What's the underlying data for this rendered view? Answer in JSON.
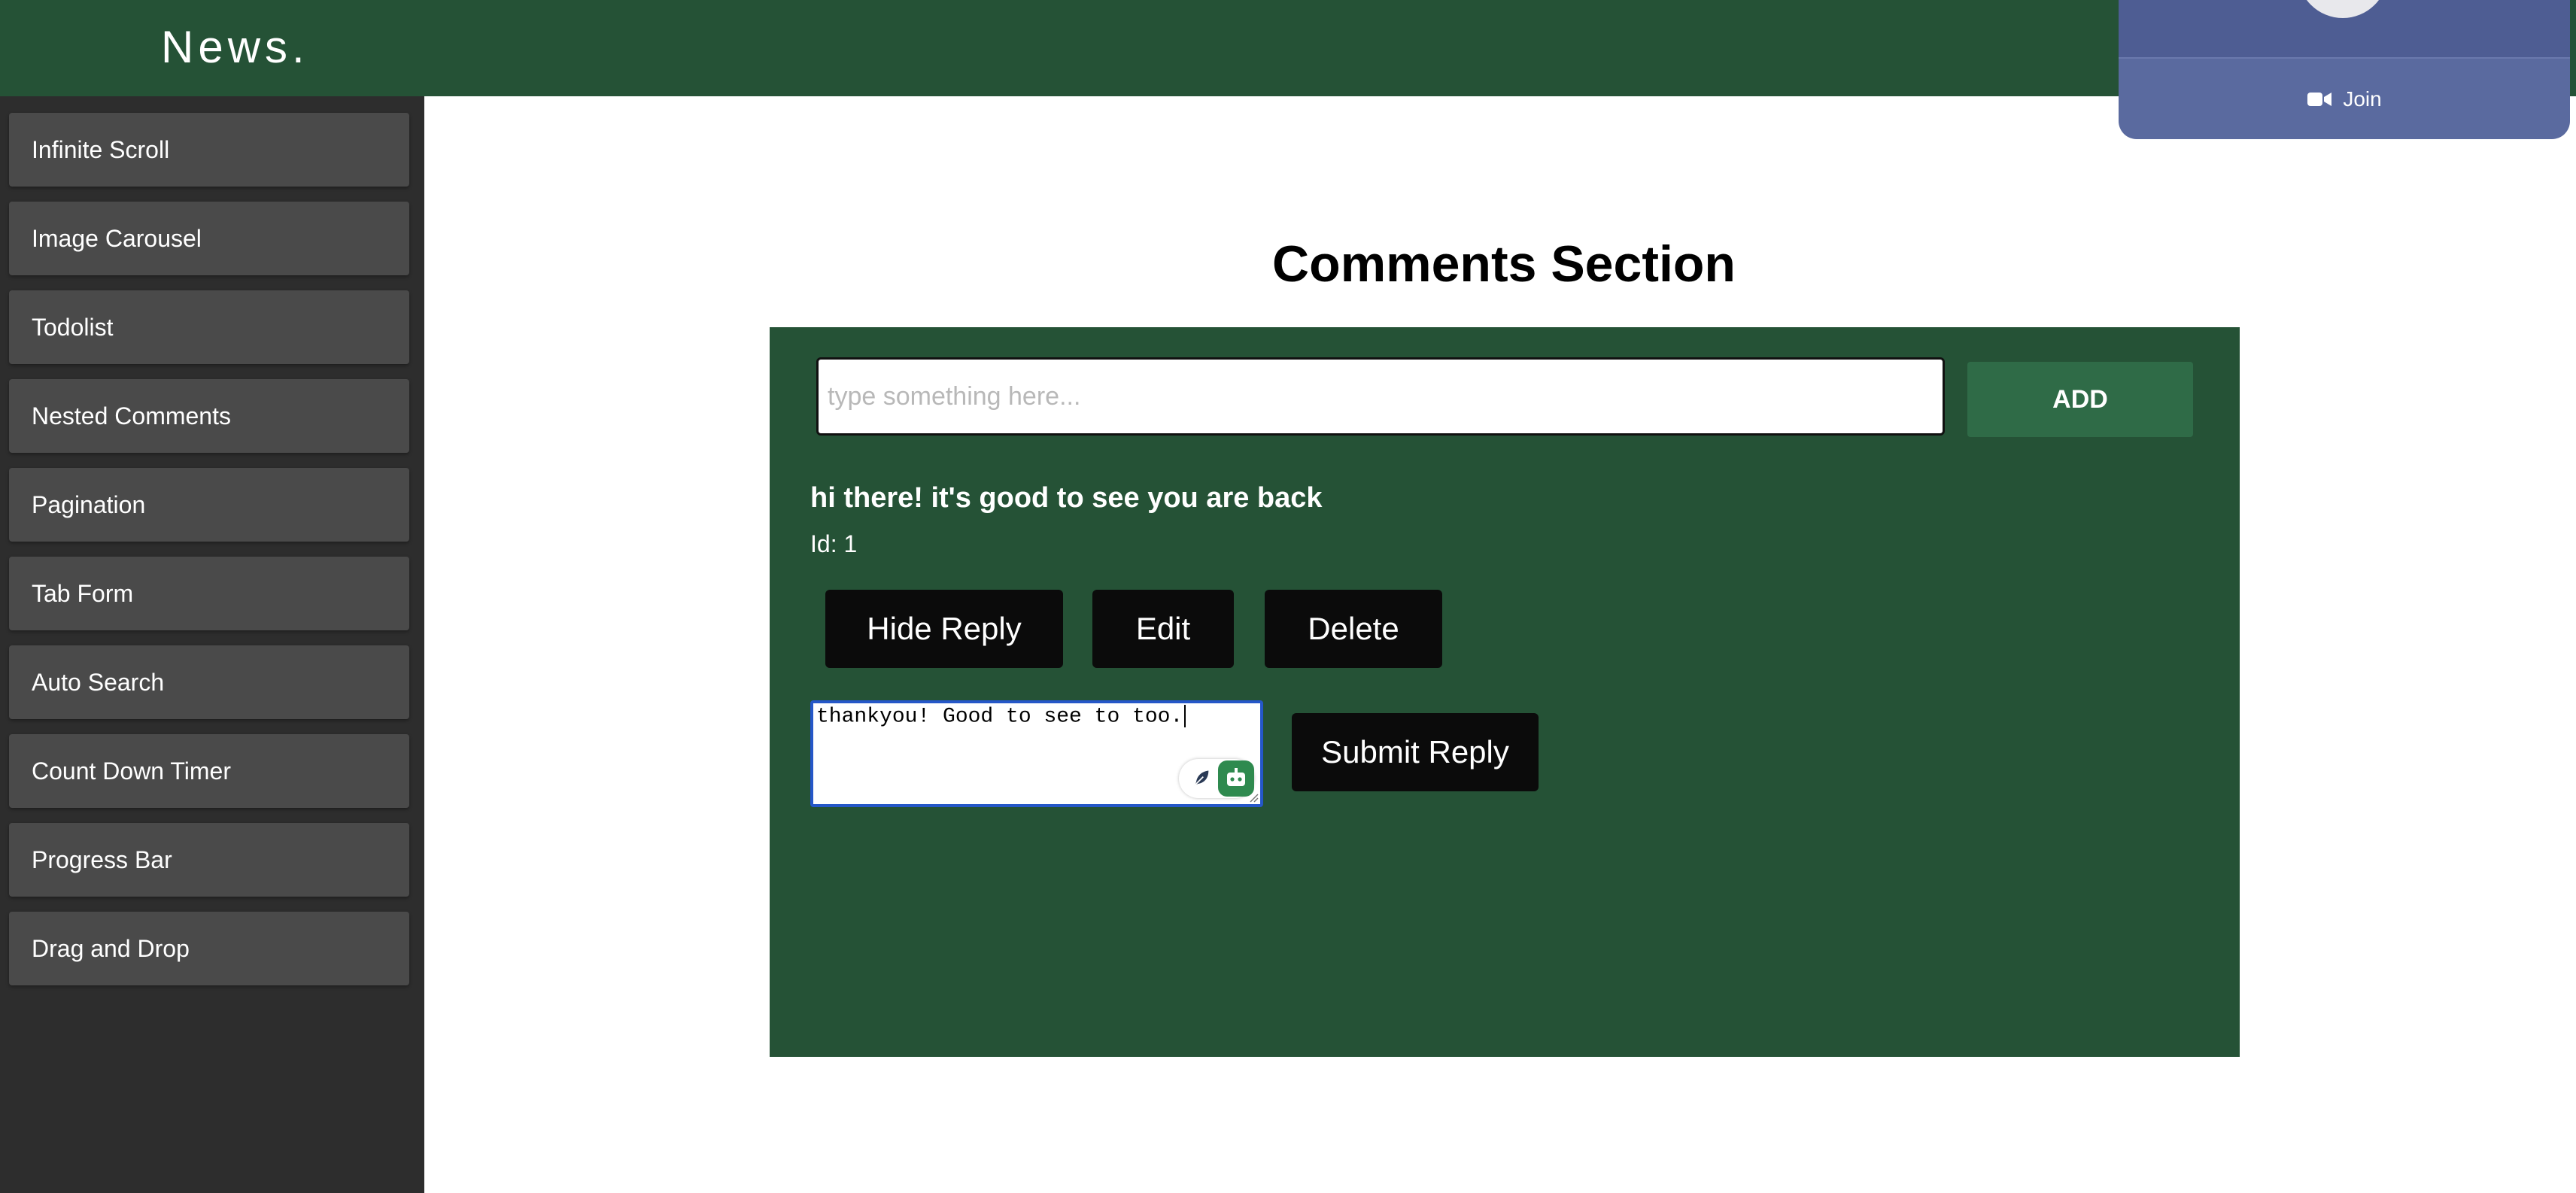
{
  "header": {
    "brand": "News."
  },
  "sidebar": {
    "items": [
      {
        "label": "Infinite Scroll"
      },
      {
        "label": "Image Carousel"
      },
      {
        "label": "Todolist"
      },
      {
        "label": "Nested Comments"
      },
      {
        "label": "Pagination"
      },
      {
        "label": "Tab Form"
      },
      {
        "label": "Auto Search"
      },
      {
        "label": "Count Down Timer"
      },
      {
        "label": "Progress Bar"
      },
      {
        "label": "Drag and Drop"
      }
    ]
  },
  "main": {
    "title": "Comments Section",
    "input": {
      "placeholder": "type something here...",
      "value": ""
    },
    "add_label": "ADD",
    "comment": {
      "text": "hi there! it's good to see you are back",
      "id_label": "Id: 1",
      "hide_reply_label": "Hide Reply",
      "edit_label": "Edit",
      "delete_label": "Delete"
    },
    "reply": {
      "value": "thankyou! Good to see to too.",
      "submit_label": "Submit Reply"
    }
  },
  "call_popover": {
    "join_label": "Join"
  },
  "colors": {
    "header_bg": "#255236",
    "sidebar_bg": "#2d2d2d",
    "panel_bg": "#255236",
    "add_button_bg": "#2f6b47",
    "popover_bg": "#5a6a9f"
  },
  "icons": [
    "feather-icon",
    "bot-icon",
    "video-camera-icon",
    "resize-handle-icon"
  ]
}
